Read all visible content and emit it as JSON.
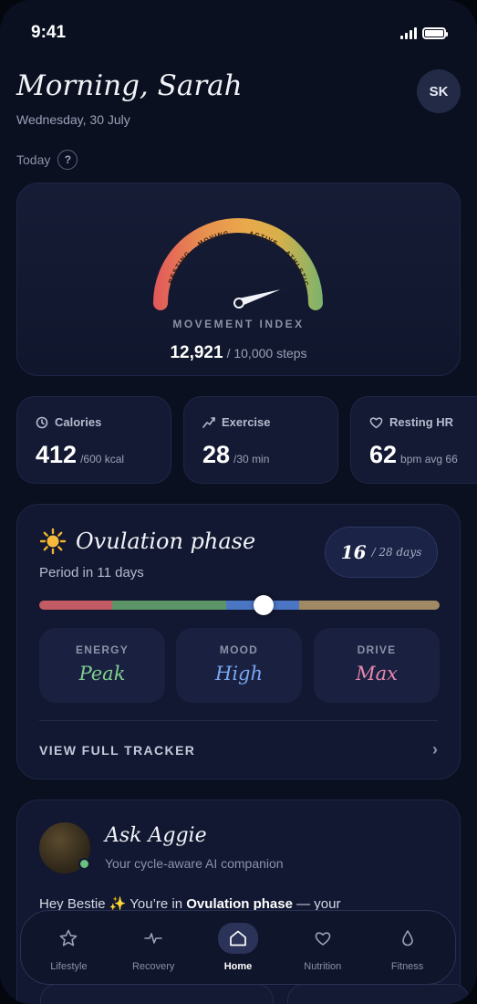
{
  "status_bar": {
    "time": "9:41"
  },
  "header": {
    "greeting": "Morning, Sarah",
    "date": "Wednesday, 30 July",
    "avatar_initials": "SK",
    "today_label": "Today",
    "help_glyph": "?"
  },
  "movement": {
    "title": "MOVEMENT INDEX",
    "steps": "12,921",
    "goal": "/ 10,000 steps",
    "zones": [
      "RESTING",
      "MOVING",
      "ACTIVE",
      "ATHLETIC"
    ],
    "needle_level": 0.9
  },
  "stats": [
    {
      "label": "Calories",
      "value": "412",
      "unit": "/600 kcal",
      "icon": "clock-icon"
    },
    {
      "label": "Exercise",
      "value": "28",
      "unit": "/30 min",
      "icon": "trend-icon"
    },
    {
      "label": "Resting HR",
      "value": "62",
      "unit": "bpm avg 66",
      "icon": "heart-icon"
    }
  ],
  "cycle": {
    "phase": "Ovulation phase",
    "period_text": "Period in 11 days",
    "day": "16",
    "total": "/ 28 days",
    "progress": 0.56,
    "segment_colors": [
      "#c25b63",
      "#5d9468",
      "#4b76c4",
      "#a08a63"
    ],
    "metrics": [
      {
        "label": "ENERGY",
        "value": "Peak",
        "color": "#7fcf8f"
      },
      {
        "label": "MOOD",
        "value": "High",
        "color": "#7aa7f2"
      },
      {
        "label": "DRIVE",
        "value": "Max",
        "color": "#e487ae"
      }
    ],
    "view_label": "VIEW FULL TRACKER",
    "chevron": "›"
  },
  "aggie": {
    "name": "Ask Aggie",
    "subtitle": "Your cycle-aware AI companion",
    "msg_pre": "Hey Bestie ✨ You’re in ",
    "msg_bold": "Ovulation phase",
    "msg_post": " — your"
  },
  "tabs": [
    {
      "label": "Lifestyle",
      "icon": "star-icon",
      "active": false
    },
    {
      "label": "Recovery",
      "icon": "pulse-icon",
      "active": false
    },
    {
      "label": "Home",
      "icon": "home-icon",
      "active": true
    },
    {
      "label": "Nutrition",
      "icon": "heart-icon",
      "active": false
    },
    {
      "label": "Fitness",
      "icon": "drop-icon",
      "active": false
    }
  ]
}
